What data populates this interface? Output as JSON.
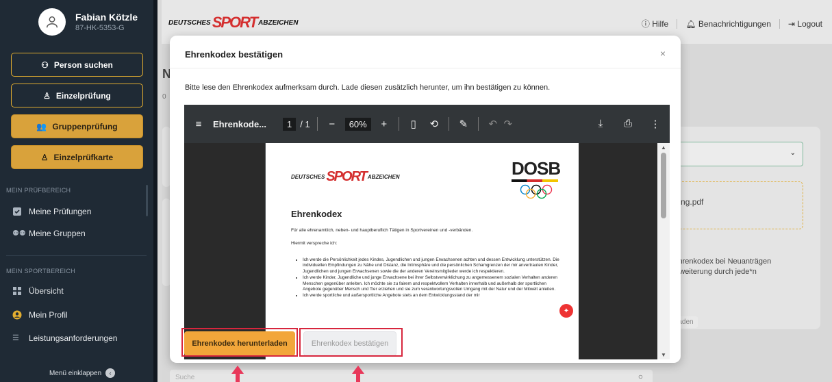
{
  "user": {
    "name": "Fabian Kötzle",
    "id": "87-HK-5353-G"
  },
  "sidebar": {
    "buttons": [
      "Person suchen",
      "Einzelprüfung",
      "Gruppenprüfung",
      "Einzelprüfkarte"
    ],
    "section1": "MEIN PRÜFBEREICH",
    "section1_items": [
      "Meine Prüfungen",
      "Meine Gruppen"
    ],
    "section2": "MEIN SPORTBEREICH",
    "section2_items": [
      "Übersicht",
      "Mein Profil",
      "Leistungsanforderungen"
    ],
    "collapse": "Menü einklappen"
  },
  "logo": {
    "left": "DEUTSCHES",
    "mid": "SPORT",
    "right": "ABZEICHEN"
  },
  "topnav": {
    "help": "Hilfe",
    "notifications": "Benachrichtigungen",
    "logout": "Logout"
  },
  "background": {
    "heading_fragment": "N",
    "sub_fragment": "0",
    "file_fragment": "gerung.pdf",
    "colon_fragment": ":",
    "text_line1": "les Ehrenkodex bei Neuanträgen",
    "text_line2": "ng/Erweiterung durch jede*n",
    "upload_fragment": "ochladen",
    "search_placeholder": "Suche"
  },
  "modal": {
    "title": "Ehrenkodex bestätigen",
    "intro": "Bitte lese den Ehrenkodex aufmerksam durch. Lade diesen zusätzlich herunter, um ihn bestätigen zu können.",
    "download_button": "Ehrenkodex herunterladen",
    "confirm_button": "Ehrenkodex bestätigen"
  },
  "pdf": {
    "filename": "Ehrenkode...",
    "page_current": "1",
    "page_total": "/ 1",
    "zoom": "60%",
    "doc_logo_left": "DEUTSCHES",
    "doc_logo_mid": "SPORT",
    "doc_logo_right": "ABZEICHEN",
    "dosb": "DOSB",
    "heading": "Ehrenkodex",
    "para1": "Für alle ehrenamtlich, neben- und hauptberuflich Tätigen in Sportvereinen und -verbänden.",
    "para2": "Hiermit verspreche ich:",
    "bullets": [
      "Ich werde die Persönlichkeit jedes Kindes, Jugendlichen und jungen Erwachsenen achten und dessen Entwicklung unterstützen. Die individuellen Empfindungen zu Nähe und Distanz, die Intimsphäre und die persönlichen Schamgrenzen der mir anvertrauten Kinder, Jugendlichen und jungen Erwachsenen sowie die der anderen Vereinsmitglieder werde ich respektieren.",
      "Ich werde Kinder, Jugendliche und junge Erwachsene bei ihrer Selbstverwirklichung zu angemessenem sozialen Verhalten anderen Menschen gegenüber anleiten. Ich möchte sie zu fairem und respektvollem Verhalten innerhalb und außerhalb der sportlichen Angebote gegenüber Mensch und Tier erziehen und sie zum verantwortungsvollen Umgang mit der Natur und der Mitwelt anleiten.",
      "Ich werde sportliche und außersportliche Angebote stets an dem Entwicklungsstand der mir"
    ]
  },
  "colors": {
    "accent": "#f2a63a",
    "highlight": "#d7263d",
    "sidebar": "#1f2a35"
  }
}
